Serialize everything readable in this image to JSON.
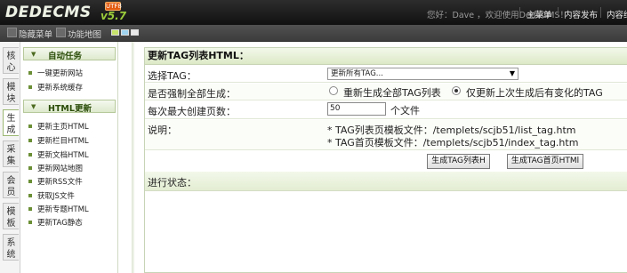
{
  "header": {
    "logo_text": "DEDECMS",
    "logo_version": "v5.7",
    "logo_badge": "UTF8",
    "greeting": "您好：Dave ，欢迎使用DedeCMS！",
    "nav": [
      "主菜单",
      "内容发布",
      "内容维"
    ]
  },
  "subbar": {
    "items": [
      "隐藏菜单",
      "功能地图"
    ]
  },
  "tabs": [
    "核心",
    "模块",
    "生成",
    "采集",
    "会员",
    "模板",
    "系统"
  ],
  "menu": {
    "sections": [
      {
        "title": "自动任务",
        "items": [
          "一键更新网站",
          "更新系统缓存"
        ]
      },
      {
        "title": "HTML更新",
        "items": [
          "更新主页HTML",
          "更新栏目HTML",
          "更新文档HTML",
          "更新网站地图",
          "更新RSS文件",
          "获取JS文件",
          "更新专题HTML",
          "更新TAG静态"
        ]
      }
    ]
  },
  "panel": {
    "title": "更新TAG列表HTML：",
    "select_tag_label": "选择TAG：",
    "select_tag_value": "更新所有TAG...",
    "force_label": "是否强制全部生成：",
    "force_options": [
      "重新生成全部TAG列表",
      "仅更新上次生成后有变化的TAG"
    ],
    "force_selected": 1,
    "max_pages_label": "每次最大创建页数：",
    "max_pages_value": "50",
    "max_pages_unit": "个文件",
    "notes_label": "说明：",
    "notes": [
      "* TAG列表页模板文件：/templets/scjb51/list_tag.htm",
      "* TAG首页模板文件：/templets/scjb51/index_tag.htm"
    ],
    "buttons": [
      "生成TAG列表H",
      "生成TAG首页HTMl"
    ],
    "progress_label": "进行状态："
  }
}
